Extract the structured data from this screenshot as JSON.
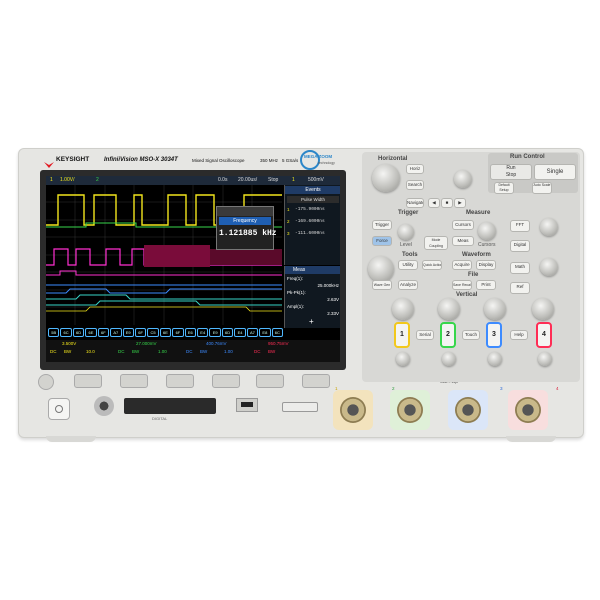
{
  "brand": {
    "logo_text": "KEYSIGHT",
    "model": "InfiniiVision MSO-X 3034T",
    "subtitle": "Mixed Signal Oscilloscope",
    "bandwidth": "350 MHz",
    "sample_rate": "5 GSa/s",
    "mega_zoom": "MEGA ZOOM",
    "mega_zoom_sub": "technology"
  },
  "screen": {
    "status": {
      "ch1": "1",
      "volts_div": "1.00V/",
      "ch2": "2",
      "time_offset": "0.0s",
      "time_div": "20.00us/",
      "mode": "Stop",
      "trig": "1",
      "trig_level": "500mV"
    },
    "zoom_popup": {
      "title": "Frequency",
      "value": "1.121885 kHz"
    },
    "events": {
      "title": "Events",
      "subtitle": "Pulse Width",
      "rows": [
        {
          "idx": "1",
          "value": "-175.9000ns"
        },
        {
          "idx": "2",
          "value": "-169.6000ns"
        },
        {
          "idx": "3",
          "value": "-111.6000ns"
        }
      ]
    },
    "meas": {
      "title": "Meas",
      "items": [
        {
          "label": "Freq(1):",
          "value": "25.000kHz"
        },
        {
          "label": "Pk-Pk(1):",
          "value": "2.63V"
        },
        {
          "label": "Ampl(1):",
          "value": "2.33V"
        }
      ],
      "add": "+"
    },
    "bus": [
      "5B",
      "6C",
      "6D",
      "6E",
      "6F",
      "A7",
      "E9",
      "6F",
      "C5",
      "6E",
      "6F",
      "E6",
      "E4",
      "E9",
      "6D",
      "E4",
      "A7",
      "E8",
      "6C"
    ],
    "bottom": {
      "c1": "3.500V",
      "c1b": "DC",
      "c1c": "BW",
      "c1d": "10.0",
      "c2": "27.000mV",
      "c2b": "DC",
      "c2c": "BW",
      "c2d": "1.00",
      "c3": "400.76mV",
      "c3b": "DC",
      "c3c": "BW",
      "c3d": "1.00",
      "c4": "950.75mV",
      "c4b": "DC",
      "c4c": "BW"
    }
  },
  "panel": {
    "horizontal": "Horizontal",
    "run_control": "Run Control",
    "run_stop": "Run\nStop",
    "single": "Single",
    "default_setup": "Default Setup",
    "auto_scale": "Auto Scale",
    "trigger": "Trigger",
    "measure": "Measure",
    "tools": "Tools",
    "waveform": "Waveform",
    "file": "File",
    "vertical": "Vertical",
    "buttons": {
      "horiz": "Horiz",
      "search": "Search",
      "navigate": "Navigate",
      "trigger_btn": "Trigger",
      "force": "Force",
      "level": "Level",
      "mode_coupling": "Mode Coupling",
      "cursors": "Cursors",
      "meas": "Meas",
      "fft": "FFT",
      "digital": "Digital",
      "math": "Math",
      "ref": "Ref",
      "utility": "Utility",
      "quick_action": "Quick Action",
      "acquire": "Acquire",
      "display": "Display",
      "wave_gen": "Wave Gen",
      "analyze": "Analyze",
      "save_recall": "Save Recall",
      "print": "Print",
      "serial": "Serial",
      "touch": "Touch",
      "help": "Help"
    },
    "channels": [
      "1",
      "2",
      "3",
      "4"
    ]
  },
  "front": {
    "digital_label": "DIGITAL",
    "ch_markers": [
      "1",
      "2",
      "3",
      "4"
    ],
    "input_spec": "1MΩ ≈ 14pF"
  },
  "colors": {
    "ch1": "#f2e51c",
    "ch2": "#37d64b",
    "ch3": "#3d8bff",
    "ch4": "#ff2d55",
    "digital": "#ff2fd0",
    "accent": "#e31b23"
  }
}
